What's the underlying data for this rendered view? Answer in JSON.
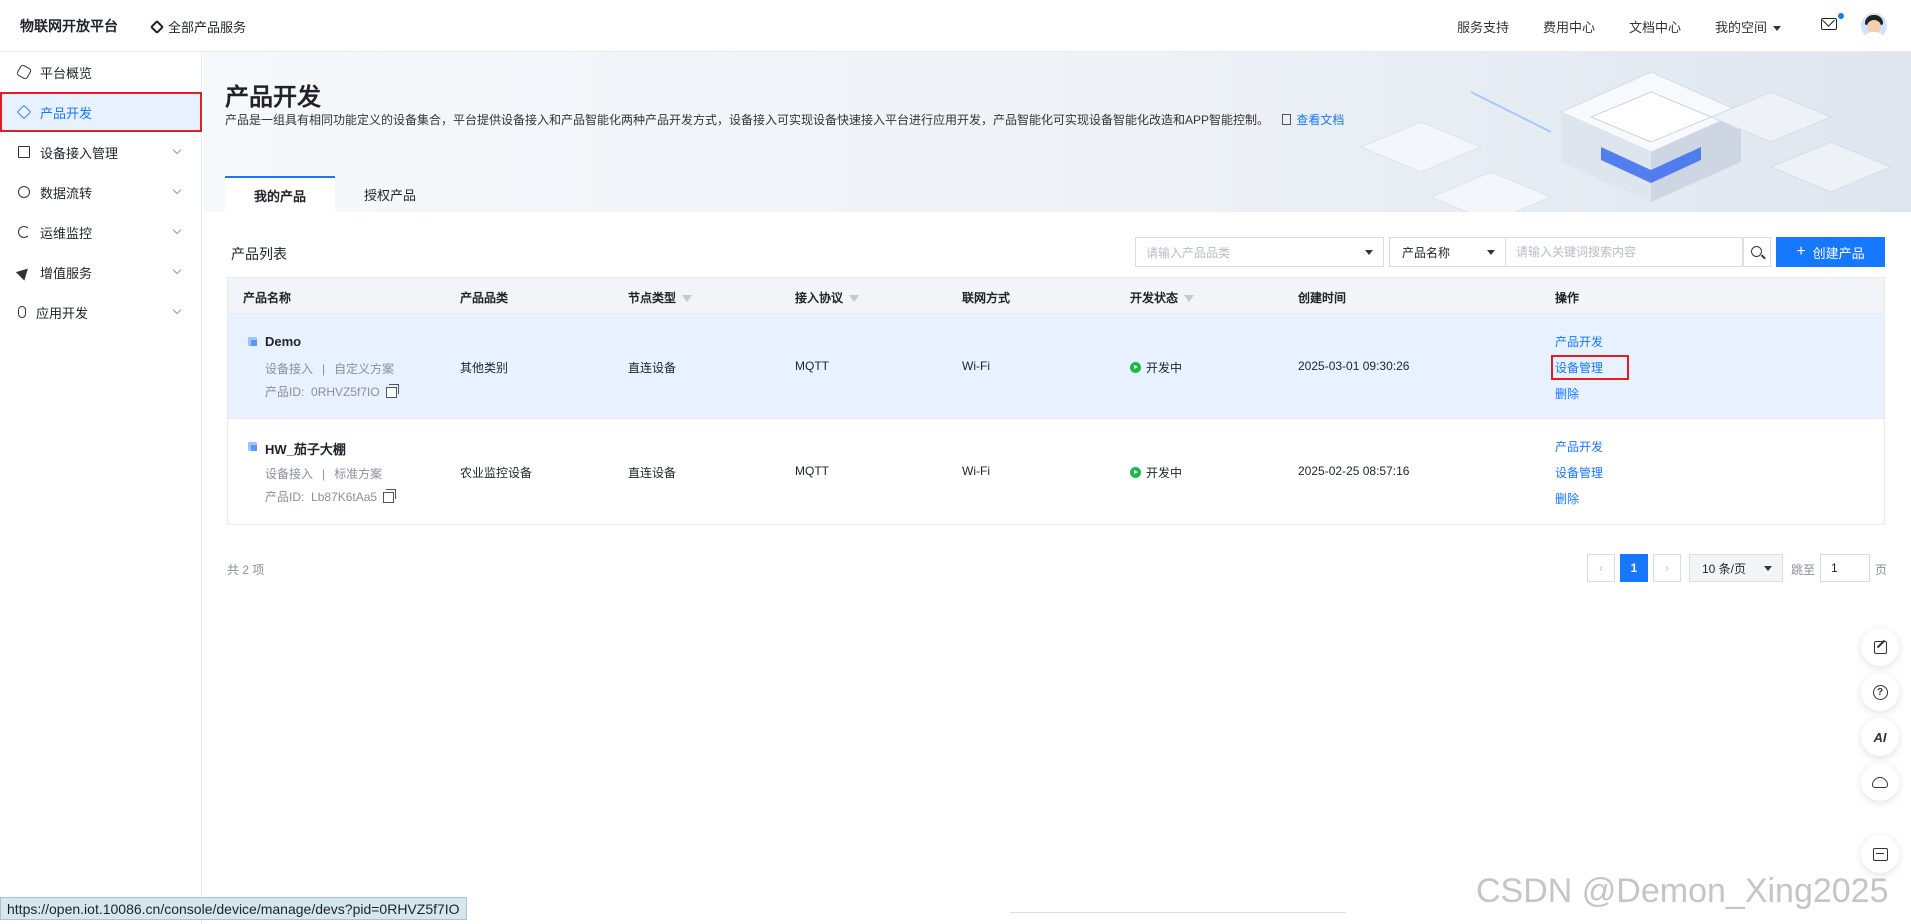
{
  "topbar": {
    "brand": "物联网开放平台",
    "all_products": "全部产品服务",
    "nav": [
      "服务支持",
      "费用中心",
      "文档中心",
      "我的空间"
    ]
  },
  "sidebar": {
    "items": [
      {
        "label": "平台概览",
        "icon": "hexagon-icon"
      },
      {
        "label": "产品开发",
        "icon": "cube-icon"
      },
      {
        "label": "设备接入管理",
        "icon": "device-icon"
      },
      {
        "label": "数据流转",
        "icon": "cycle-icon"
      },
      {
        "label": "运维监控",
        "icon": "pie-icon"
      },
      {
        "label": "增值服务",
        "icon": "plane-icon"
      },
      {
        "label": "应用开发",
        "icon": "link-icon"
      }
    ]
  },
  "header": {
    "title": "产品开发",
    "desc": "产品是一组具有相同功能定义的设备集合，平台提供设备接入和产品智能化两种产品开发方式，设备接入可实现设备快速接入平台进行应用开发，产品智能化可实现设备智能化改造和APP智能控制。",
    "doc_link": "查看文档"
  },
  "tabs": [
    "我的产品",
    "授权产品"
  ],
  "list": {
    "title": "产品列表",
    "category_placeholder": "请输入产品品类",
    "field_select": "产品名称",
    "search_placeholder": "请输入关键词搜索内容",
    "create_button": "创建产品"
  },
  "table": {
    "headers": [
      "产品名称",
      "产品品类",
      "节点类型",
      "接入协议",
      "联网方式",
      "开发状态",
      "创建时间",
      "操作"
    ],
    "rows": [
      {
        "name": "Demo",
        "access": "设备接入",
        "scheme": "自定义方案",
        "id_label": "产品ID:",
        "id": "0RHVZ5f7IO",
        "category": "其他类别",
        "node": "直连设备",
        "protocol": "MQTT",
        "network": "Wi-Fi",
        "status": "开发中",
        "created": "2025-03-01 09:30:26",
        "ops": [
          "产品开发",
          "设备管理",
          "删除"
        ]
      },
      {
        "name": "HW_茄子大棚",
        "access": "设备接入",
        "scheme": "标准方案",
        "id_label": "产品ID:",
        "id": "Lb87K6tAa5",
        "category": "农业监控设备",
        "node": "直连设备",
        "protocol": "MQTT",
        "network": "Wi-Fi",
        "status": "开发中",
        "created": "2025-02-25 08:57:16",
        "ops": [
          "产品开发",
          "设备管理",
          "删除"
        ]
      }
    ]
  },
  "pagination": {
    "total": "共 2 项",
    "prev": "‹",
    "current": "1",
    "next": "›",
    "page_size": "10 条/页",
    "jump_label": "跳至",
    "jump_value": "1",
    "page_suffix": "页"
  },
  "float_tools": {
    "ai_label": "AI"
  },
  "statusbar": {
    "url": "https://open.iot.10086.cn/console/device/manage/devs?pid=0RHVZ5f7IO"
  },
  "watermark": "CSDN @Demon_Xing2025",
  "colors": {
    "accent": "#1677ff",
    "status_green": "#1fb84f",
    "highlight_red": "#e02020"
  }
}
